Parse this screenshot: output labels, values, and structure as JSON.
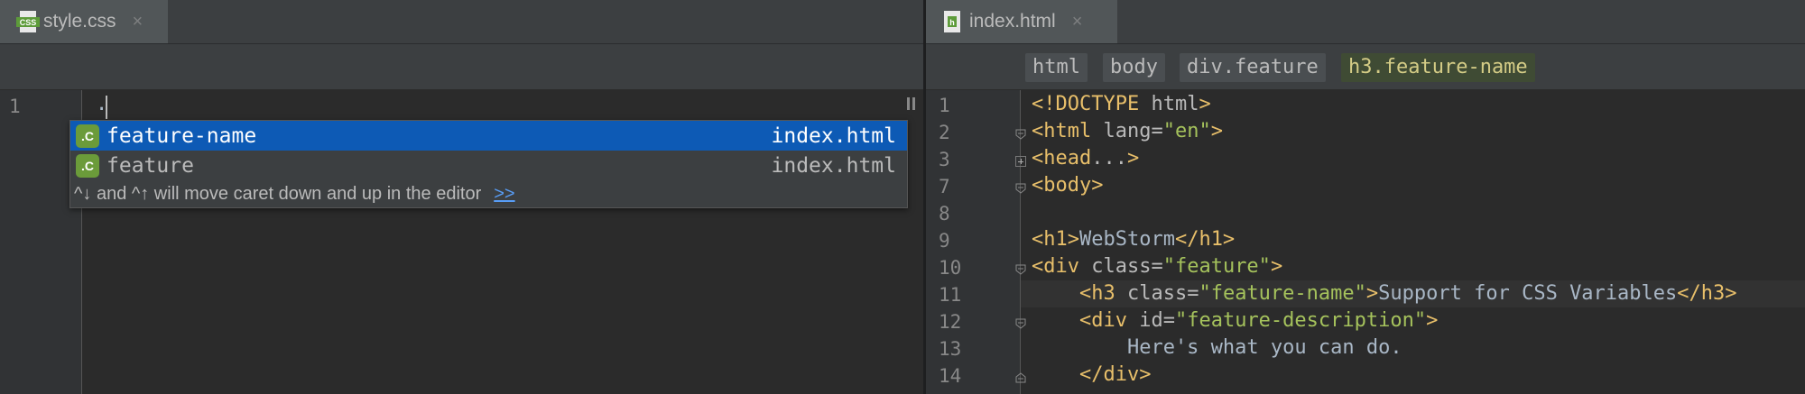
{
  "left_tab": {
    "label": "style.css",
    "icon": "css-file-icon",
    "close": "×"
  },
  "right_tab": {
    "label": "index.html",
    "icon": "html-file-icon",
    "close": "×"
  },
  "breadcrumbs": [
    "html",
    "body",
    "div.feature",
    "h3.feature-name"
  ],
  "css_editor": {
    "line_number": "1",
    "typed_text": "."
  },
  "completion_popup": {
    "items": [
      {
        "name": "feature-name",
        "source": "index.html",
        "icon": "css-class-icon",
        "icon_text": ".C",
        "selected": true
      },
      {
        "name": "feature",
        "source": "index.html",
        "icon": "css-class-icon",
        "icon_text": ".C",
        "selected": false
      }
    ],
    "hint": "^↓ and ^↑ will move caret down and up in the editor",
    "hint_link": ">>"
  },
  "html_editor": {
    "lines": [
      {
        "n": "1",
        "parts": [
          [
            "t",
            "<!DOCTYPE "
          ],
          [
            "a",
            "html"
          ],
          [
            "t",
            ">"
          ]
        ]
      },
      {
        "n": "2",
        "parts": [
          [
            "t",
            "<html "
          ],
          [
            "a",
            "lang="
          ],
          [
            "v",
            "\"en\""
          ],
          [
            "t",
            ">"
          ]
        ]
      },
      {
        "n": "3",
        "parts": [
          [
            "t",
            "<head"
          ],
          [
            "a",
            "..."
          ],
          [
            "t",
            ">"
          ]
        ]
      },
      {
        "n": "7",
        "parts": [
          [
            "t",
            "<body>"
          ]
        ]
      },
      {
        "n": "8",
        "parts": []
      },
      {
        "n": "9",
        "parts": [
          [
            "t",
            "<h1>"
          ],
          [
            "txt",
            "WebStorm"
          ],
          [
            "t",
            "</h1>"
          ]
        ]
      },
      {
        "n": "10",
        "parts": [
          [
            "t",
            "<div "
          ],
          [
            "a",
            "class="
          ],
          [
            "v",
            "\"feature\""
          ],
          [
            "t",
            ">"
          ]
        ]
      },
      {
        "n": "11",
        "parts": [
          [
            "txt",
            "    "
          ],
          [
            "t",
            "<h3 "
          ],
          [
            "a",
            "class="
          ],
          [
            "v",
            "\"feature-name\""
          ],
          [
            "t",
            ">"
          ],
          [
            "txt",
            "Support for CSS Variables"
          ],
          [
            "t",
            "</h3>"
          ]
        ]
      },
      {
        "n": "12",
        "parts": [
          [
            "txt",
            "    "
          ],
          [
            "t",
            "<div "
          ],
          [
            "a",
            "id="
          ],
          [
            "v",
            "\"feature-description\""
          ],
          [
            "t",
            ">"
          ]
        ]
      },
      {
        "n": "13",
        "parts": [
          [
            "txt",
            "        Here's what you can do."
          ]
        ]
      },
      {
        "n": "14",
        "parts": [
          [
            "txt",
            "    "
          ],
          [
            "t",
            "</div>"
          ]
        ]
      }
    ]
  },
  "colors": {
    "tag": "#e8bf6a",
    "attr": "#bababa",
    "value": "#a5c25c",
    "text": "#a9b7c6",
    "selection": "#0d5ab5"
  }
}
